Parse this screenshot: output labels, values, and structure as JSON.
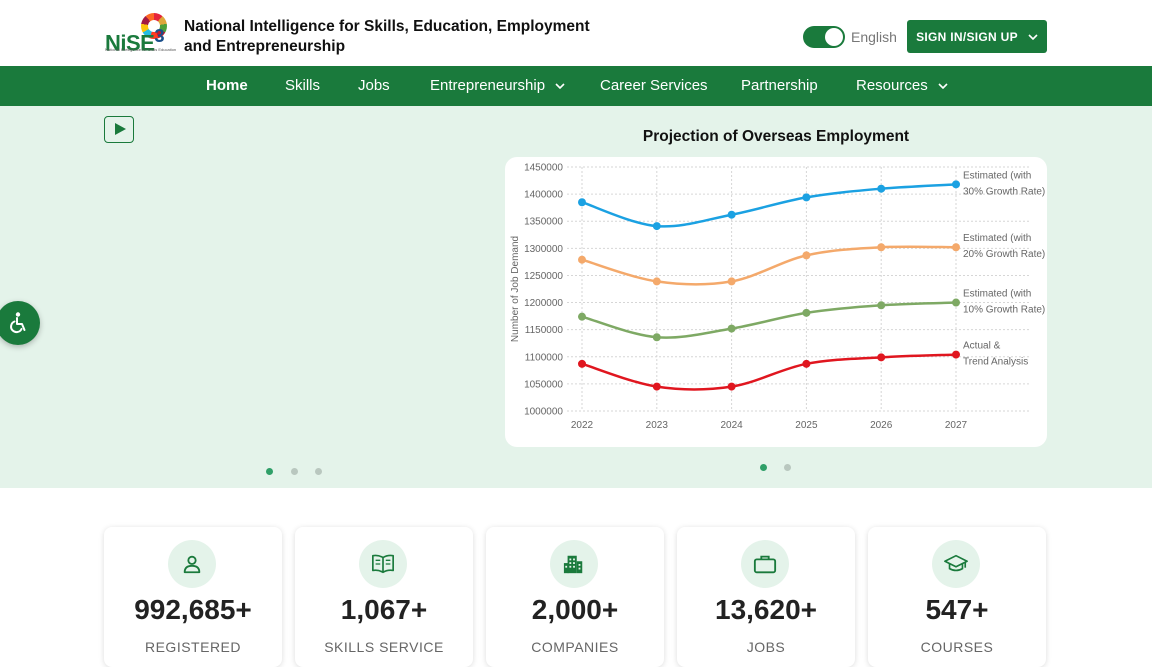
{
  "header": {
    "logo_text": "NiSE",
    "logo_superscript": "3",
    "logo_subtext": "National Intelligence for Skills Education Employment and Entrepreneurship",
    "site_title_line1": "National Intelligence for Skills, Education, Employment",
    "site_title_line2": "and Entrepreneurship",
    "language_label": "English",
    "language_toggle_on": true,
    "signin_label": "SIGN IN/SIGN UP"
  },
  "nav": {
    "items": [
      {
        "label": "Home",
        "active": true
      },
      {
        "label": "Skills"
      },
      {
        "label": "Jobs"
      },
      {
        "label": "Entrepreneurship",
        "dropdown": true
      },
      {
        "label": "Career Services"
      },
      {
        "label": "Partnership"
      },
      {
        "label": "Resources",
        "dropdown": true
      }
    ]
  },
  "hero": {
    "left_carousel_dots": 3,
    "left_active_dot": 0,
    "right_carousel_dots": 2,
    "right_active_dot": 0
  },
  "chart_data": {
    "type": "line",
    "title": "Projection of Overseas Employment",
    "xlabel": "",
    "ylabel": "Number of Job Demand",
    "x": [
      2022,
      2023,
      2024,
      2025,
      2026,
      2027
    ],
    "ylim": [
      1000000,
      1450000
    ],
    "yticks": [
      1000000,
      1050000,
      1100000,
      1150000,
      1200000,
      1250000,
      1300000,
      1350000,
      1400000,
      1450000
    ],
    "grid": true,
    "legend": "right-inline",
    "series": [
      {
        "name": "Estimated (with 30% Growth Rate)",
        "label_lines": [
          "Estimated (with",
          "30% Growth Rate)"
        ],
        "color": "#1ba1e2",
        "values": [
          1385000,
          1341000,
          1362000,
          1394000,
          1410000,
          1418000
        ]
      },
      {
        "name": "Estimated (with 20% Growth Rate)",
        "label_lines": [
          "Estimated (with",
          "20% Growth Rate)"
        ],
        "color": "#f4a96b",
        "values": [
          1279000,
          1239000,
          1239000,
          1287000,
          1302000,
          1302000
        ]
      },
      {
        "name": "Estimated (with 10% Growth Rate)",
        "label_lines": [
          "Estimated (with",
          "10% Growth Rate)"
        ],
        "color": "#7ea964",
        "values": [
          1174000,
          1136000,
          1152000,
          1181000,
          1195000,
          1200000
        ]
      },
      {
        "name": "Actual & Trend Analysis",
        "label_lines": [
          "Actual &",
          "Trend Analysis"
        ],
        "color": "#e0161f",
        "values": [
          1087000,
          1045000,
          1045000,
          1087000,
          1099000,
          1104000
        ]
      }
    ]
  },
  "stats": [
    {
      "icon": "person-icon",
      "value": "992,685+",
      "label": "REGISTERED"
    },
    {
      "icon": "book-icon",
      "value": "1,067+",
      "label": "SKILLS SERVICE"
    },
    {
      "icon": "building-icon",
      "value": "2,000+",
      "label": "COMPANIES"
    },
    {
      "icon": "briefcase-icon",
      "value": "13,620+",
      "label": "JOBS"
    },
    {
      "icon": "graduation-cap-icon",
      "value": "547+",
      "label": "COURSES"
    }
  ],
  "colors": {
    "brand_green": "#1a7a3c",
    "hero_bg": "#e4f3ea"
  }
}
